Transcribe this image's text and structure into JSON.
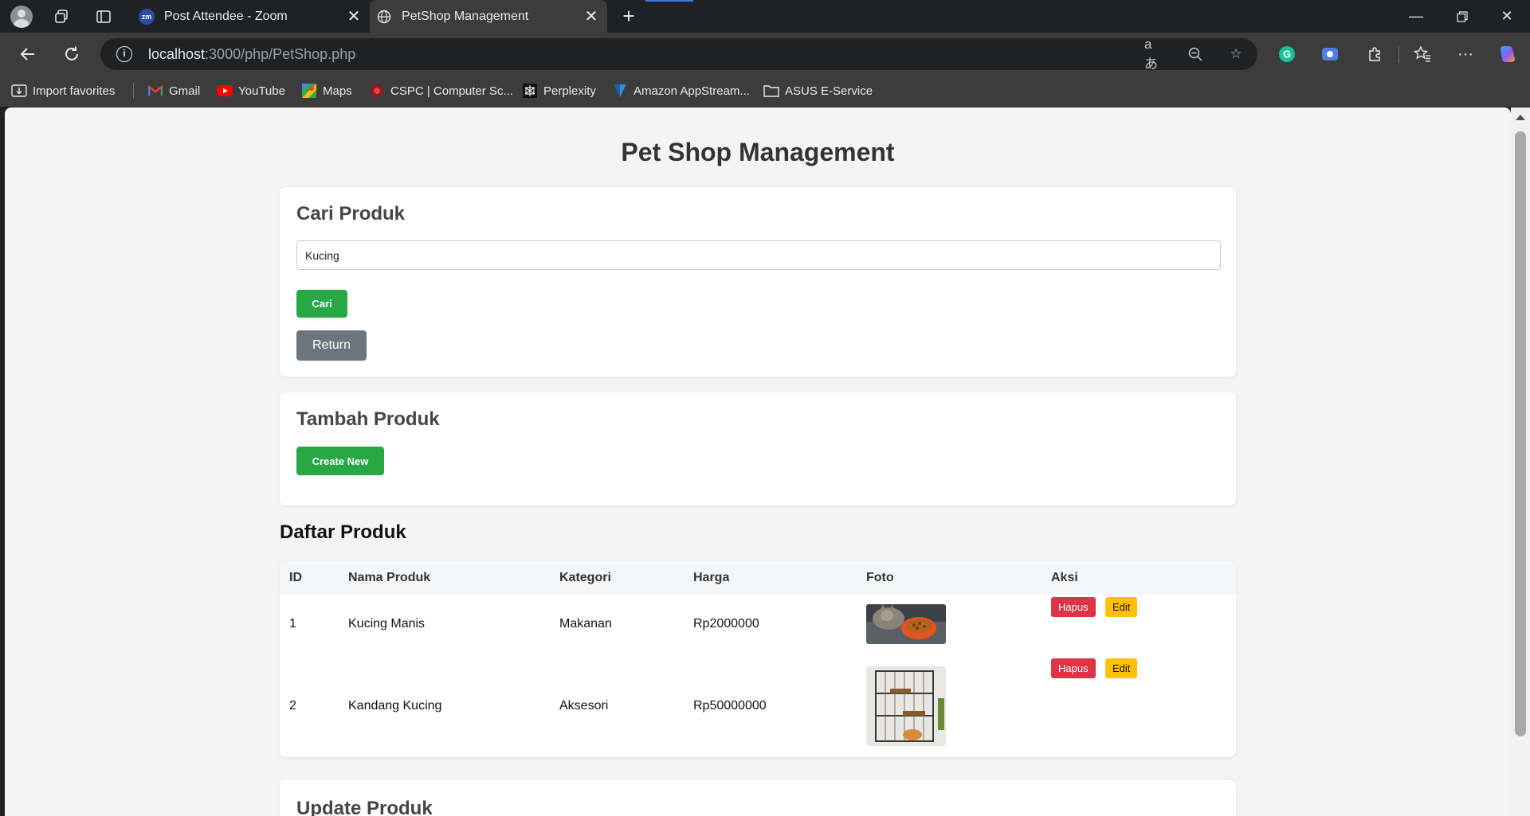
{
  "browser": {
    "tabs": [
      {
        "title": "Post Attendee - Zoom",
        "favicon": "zoom-icon",
        "active": false
      },
      {
        "title": "PetShop Management",
        "favicon": "globe-icon",
        "active": true
      }
    ],
    "address": {
      "host": "localhost",
      "path": ":3000/php/PetShop.php"
    },
    "bookmarks": [
      {
        "label": "Import favorites",
        "icon": "import-icon"
      },
      {
        "label": "Gmail",
        "icon": "gmail-icon"
      },
      {
        "label": "YouTube",
        "icon": "youtube-icon"
      },
      {
        "label": "Maps",
        "icon": "maps-icon"
      },
      {
        "label": "CSPC | Computer Sc...",
        "icon": "cspc-icon"
      },
      {
        "label": "Perplexity",
        "icon": "perplexity-icon"
      },
      {
        "label": "Amazon AppStream...",
        "icon": "appstream-icon"
      },
      {
        "label": "ASUS E-Service",
        "icon": "folder-icon"
      }
    ]
  },
  "page": {
    "title": "Pet Shop Management",
    "search": {
      "heading": "Cari Produk",
      "value": "Kucing",
      "search_label": "Cari",
      "return_label": "Return"
    },
    "add": {
      "heading": "Tambah Produk",
      "create_label": "Create New"
    },
    "list": {
      "heading": "Daftar Produk",
      "columns": [
        "ID",
        "Nama Produk",
        "Kategori",
        "Harga",
        "Foto",
        "Aksi"
      ],
      "rows": [
        {
          "id": "1",
          "name": "Kucing Manis",
          "category": "Makanan",
          "price": "Rp2000000",
          "photo": "cat-food-photo",
          "delete_label": "Hapus",
          "edit_label": "Edit"
        },
        {
          "id": "2",
          "name": "Kandang Kucing",
          "category": "Aksesori",
          "price": "Rp50000000",
          "photo": "cat-cage-photo",
          "delete_label": "Hapus",
          "edit_label": "Edit"
        }
      ]
    },
    "update": {
      "heading": "Update Produk"
    }
  },
  "colors": {
    "primary_green": "#28a745",
    "return_gray": "#6c757d",
    "delete_red": "#dc3545",
    "edit_yellow": "#ffc107"
  }
}
